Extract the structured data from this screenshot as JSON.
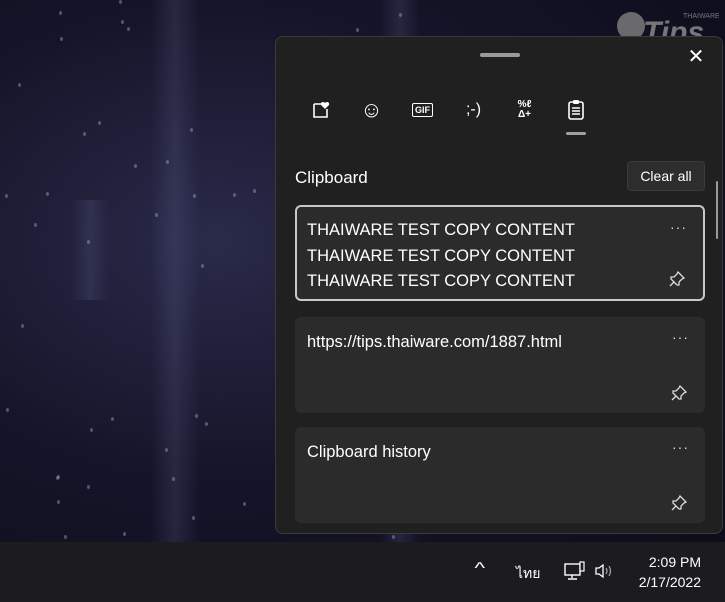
{
  "watermark": {
    "logo_text": "Tips",
    "logo_subtext": "THAIWARE"
  },
  "panel": {
    "close_icon": "close-icon",
    "tabs": [
      {
        "name": "favorites-tab",
        "icon": "heart-sticker-icon"
      },
      {
        "name": "emoji-tab",
        "icon": "smiley-icon",
        "glyph": "☺"
      },
      {
        "name": "gif-tab",
        "icon": "gif-icon",
        "glyph": "GIF"
      },
      {
        "name": "kaomoji-tab",
        "icon": "kaomoji-icon",
        "glyph": ";-)"
      },
      {
        "name": "symbols-tab",
        "icon": "symbols-icon",
        "glyph": "%ℓ\nΔ+"
      },
      {
        "name": "clipboard-tab",
        "icon": "clipboard-icon",
        "active": true
      }
    ],
    "title": "Clipboard",
    "clear_all": "Clear all",
    "items": [
      {
        "lines": [
          "THAIWARE TEST COPY CONTENT",
          "THAIWARE TEST COPY CONTENT",
          "THAIWARE TEST COPY CONTENT"
        ],
        "more": "···",
        "selected": true
      },
      {
        "lines": [
          "https://tips.thaiware.com/1887.html"
        ],
        "more": "···"
      },
      {
        "lines": [
          "Clipboard history"
        ],
        "more": "···"
      }
    ]
  },
  "taskbar": {
    "chevron": "^",
    "language": "ไทย",
    "time": "2:09 PM",
    "date": "2/17/2022"
  }
}
